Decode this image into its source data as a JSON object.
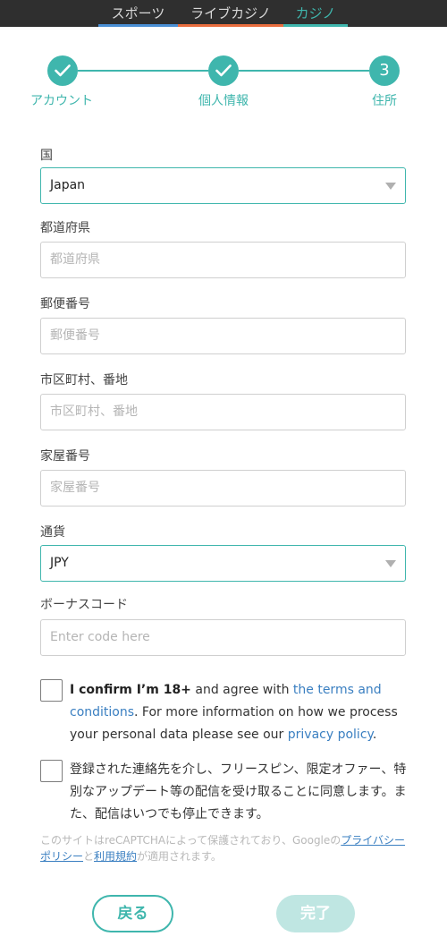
{
  "tabs": [
    {
      "label": "スポーツ",
      "bar_color": "#4a8fd4",
      "active": false
    },
    {
      "label": "ライブカジノ",
      "bar_color": "#e96d3e",
      "active": false
    },
    {
      "label": "カジノ",
      "bar_color": "#3fb6ad",
      "active": true
    }
  ],
  "stepper": {
    "steps": [
      {
        "label": "アカウント",
        "state": "done"
      },
      {
        "label": "個人情報",
        "state": "done"
      },
      {
        "label": "住所",
        "state": "current",
        "number": "3"
      }
    ],
    "accent": "#3fb6ad"
  },
  "form": {
    "country": {
      "label": "国",
      "value": "Japan"
    },
    "prefecture": {
      "label": "都道府県",
      "placeholder": "都道府県"
    },
    "postal": {
      "label": "郵便番号",
      "placeholder": "郵便番号"
    },
    "city": {
      "label": "市区町村、番地",
      "placeholder": "市区町村、番地"
    },
    "building": {
      "label": "家屋番号",
      "placeholder": "家屋番号"
    },
    "currency": {
      "label": "通貨",
      "value": "JPY"
    },
    "bonus": {
      "label": "ボーナスコード",
      "placeholder": "Enter code here"
    }
  },
  "consent": {
    "age_bold": "I confirm I’m 18+",
    "age_mid": " and agree with ",
    "terms_link": "the terms and conditions",
    "age_after": ". For more information on how we process your personal data please see our ",
    "privacy_link": "privacy policy",
    "age_end": ".",
    "marketing": "登録された連絡先を介し、フリースピン、限定オファー、特別なアップデート等の配信を受け取ることに同意します。また、配信はいつでも停止できます。"
  },
  "recaptcha": {
    "prefix": "このサイトはreCAPTCHAによって保護されており、Googleの",
    "privacy_link": "プライバシーポリシー",
    "mid": "と",
    "terms_link": "利用規約",
    "suffix": "が適用されます。"
  },
  "buttons": {
    "back": "戻る",
    "done": "完了"
  }
}
